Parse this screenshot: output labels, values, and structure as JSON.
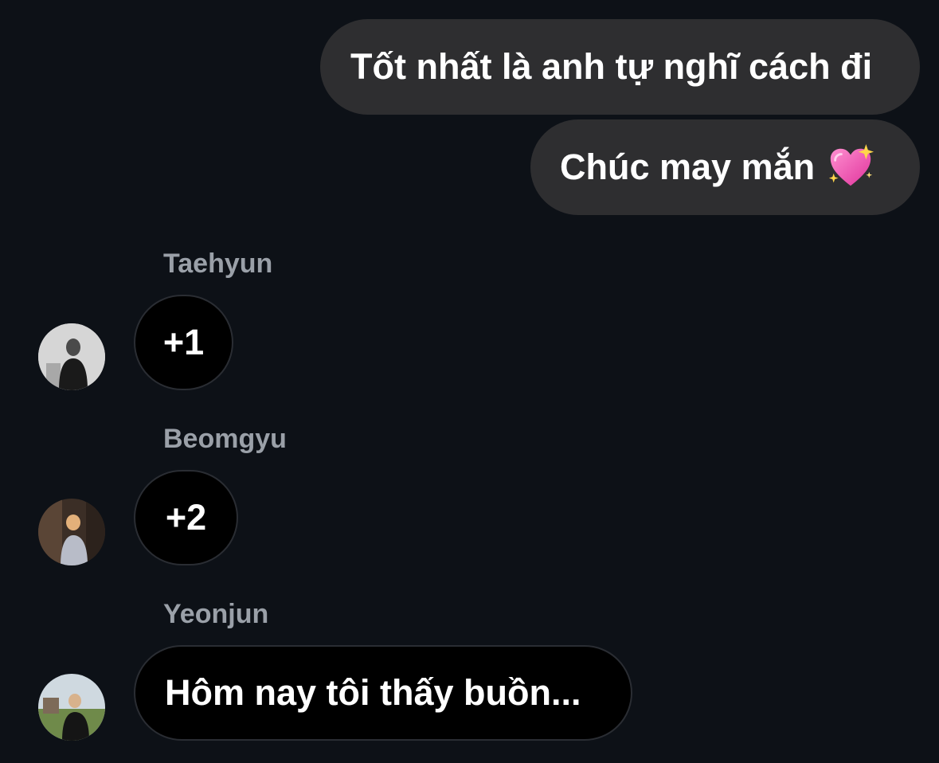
{
  "outgoing": [
    {
      "text": "Tốt nhất là anh tự nghĩ cách đi"
    },
    {
      "text": "Chúc may mắn",
      "emoji": "sparkling-heart-icon"
    }
  ],
  "incoming": [
    {
      "sender": "Taehyun",
      "text": "+1",
      "avatar": "taehyun-avatar"
    },
    {
      "sender": "Beomgyu",
      "text": "+2",
      "avatar": "beomgyu-avatar"
    },
    {
      "sender": "Yeonjun",
      "text": "Hôm nay tôi thấy buồn...",
      "avatar": "yeonjun-avatar"
    }
  ],
  "colors": {
    "background": "#0d1117",
    "outgoing_bubble": "#2e2e30",
    "incoming_bubble": "#000000",
    "sender_name": "#9aa0a8"
  }
}
